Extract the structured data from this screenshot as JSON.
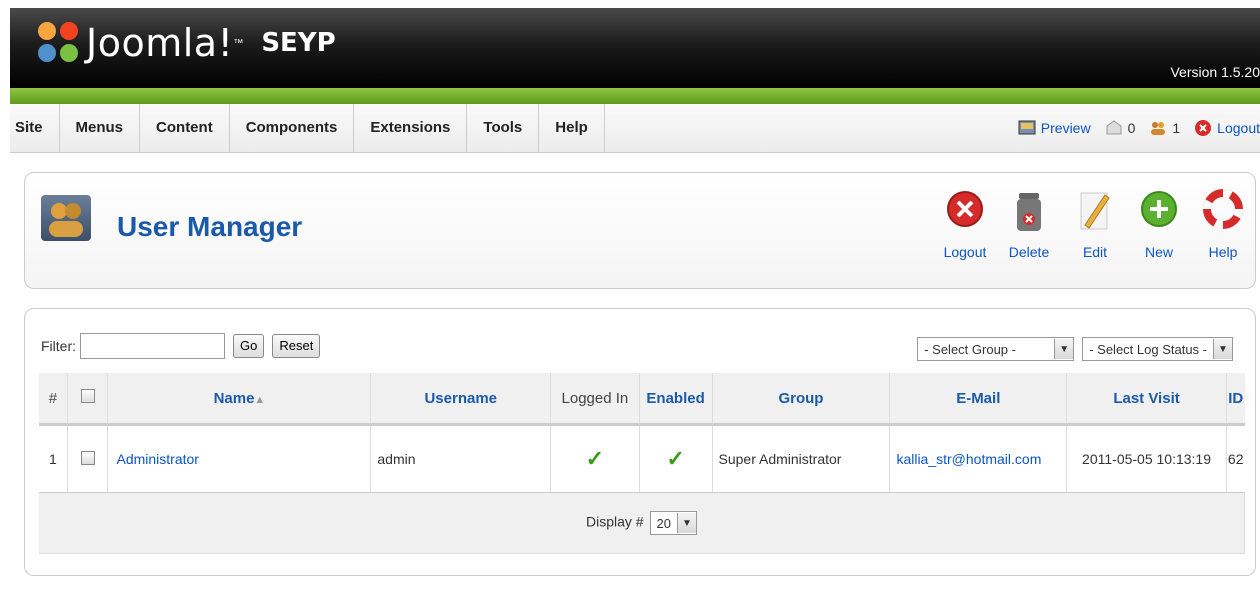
{
  "header": {
    "logo_text": "Joomla!",
    "logo_tm": "™",
    "site_name": "SEYP",
    "version": "Version 1.5.20"
  },
  "menu": {
    "items": [
      "Site",
      "Menus",
      "Content",
      "Components",
      "Extensions",
      "Tools",
      "Help"
    ]
  },
  "status": {
    "preview": "Preview",
    "messages_count": "0",
    "users_count": "1",
    "logout": "Logout"
  },
  "toolbar": {
    "title": "User Manager",
    "buttons": [
      {
        "label": "Logout",
        "icon": "logout-icon",
        "color": "#d62b2b"
      },
      {
        "label": "Delete",
        "icon": "trash-icon",
        "color": "#555555"
      },
      {
        "label": "Edit",
        "icon": "pencil-icon",
        "color": "#e8b040"
      },
      {
        "label": "New",
        "icon": "plus-icon",
        "color": "#5bb12f"
      },
      {
        "label": "Help",
        "icon": "lifebuoy-icon",
        "color": "#d62b2b"
      }
    ]
  },
  "filter": {
    "label": "Filter:",
    "value": "",
    "go": "Go",
    "reset": "Reset",
    "group_select": "- Select Group -",
    "log_status_select": "- Select Log Status -"
  },
  "table": {
    "columns": [
      "#",
      "",
      "Name",
      "Username",
      "Logged In",
      "Enabled",
      "Group",
      "E-Mail",
      "Last Visit",
      "ID"
    ],
    "sort_indicator": "▲",
    "rows": [
      {
        "num": "1",
        "name": "Administrator",
        "username": "admin",
        "logged_in": true,
        "enabled": true,
        "group": "Super Administrator",
        "email": "kallia_str@hotmail.com",
        "last_visit": "2011-05-05 10:13:19",
        "id": "62"
      }
    ]
  },
  "pagination": {
    "label": "Display #",
    "value": "20"
  },
  "colors": {
    "accent_green": "#6db033",
    "link_blue": "#0b55c4",
    "title_blue": "#1a5aa8"
  }
}
